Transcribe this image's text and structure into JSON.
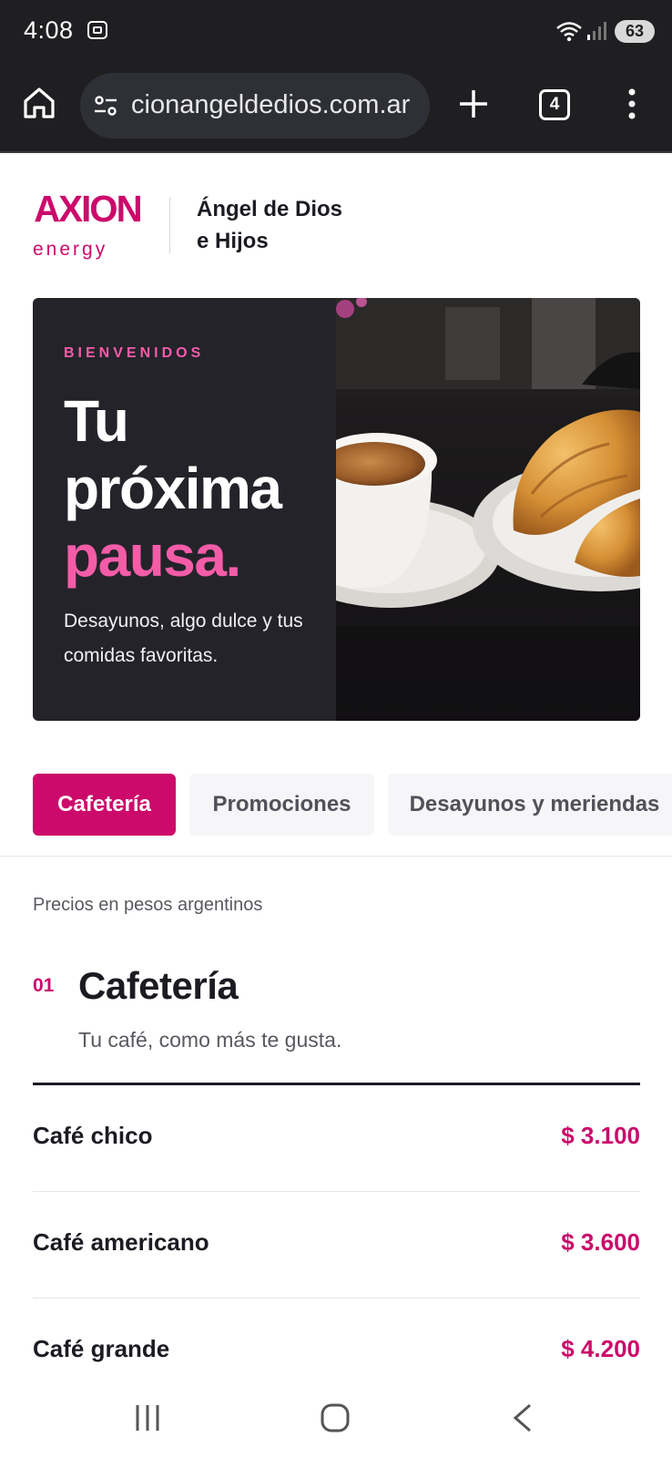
{
  "status_bar": {
    "time": "4:08",
    "battery": "63"
  },
  "browser": {
    "url": "cionangeldedios.com.ar",
    "tab_count": "4"
  },
  "header": {
    "brand": "AXION",
    "brand_sub": "energy",
    "business_line1": "Ángel de Dios",
    "business_line2": "e Hijos",
    "brand_color": "#cc0a6b"
  },
  "hero": {
    "eyebrow": "BIENVENIDOS",
    "headline_line1": "Tu",
    "headline_line2": "próxima",
    "headline_accent": "pausa.",
    "description": "Desayunos, algo dulce y tus comidas favoritas.",
    "accent_color": "#f45ca8"
  },
  "tabs": [
    {
      "label": "Cafetería",
      "active": true
    },
    {
      "label": "Promociones",
      "active": false
    },
    {
      "label": "Desayunos y meriendas",
      "active": false
    }
  ],
  "price_note": "Precios en pesos argentinos",
  "section": {
    "number": "01",
    "title": "Cafetería",
    "subtitle": "Tu café, como más te gusta."
  },
  "menu_items": [
    {
      "name": "Café chico",
      "price": "$ 3.100"
    },
    {
      "name": "Café americano",
      "price": "$ 3.600"
    },
    {
      "name": "Café grande",
      "price": "$ 4.200"
    }
  ]
}
